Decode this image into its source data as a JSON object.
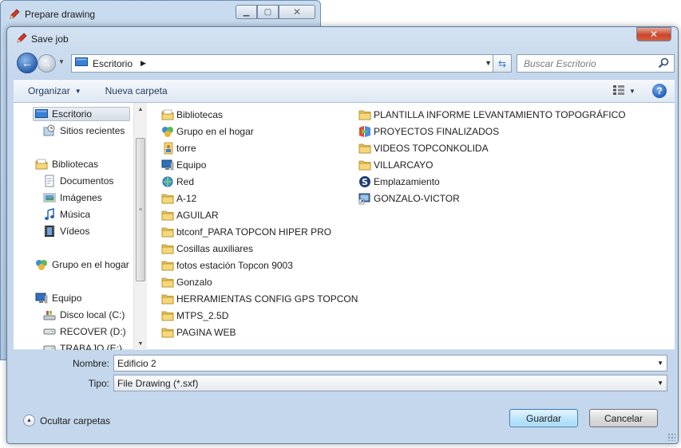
{
  "background_window": {
    "title": "Prepare drawing"
  },
  "dialog": {
    "title": "Save job"
  },
  "address_bar": {
    "crumb": "Escritorio",
    "search_placeholder": "Buscar Escritorio"
  },
  "toolbar": {
    "organize": "Organizar",
    "new_folder": "Nueva carpeta"
  },
  "nav_pane": {
    "items": [
      {
        "label": "Escritorio",
        "icon": "desktop-icon",
        "selected": true
      },
      {
        "label": "Sitios recientes",
        "icon": "recent-places-icon"
      },
      {
        "label": "Bibliotecas",
        "icon": "libraries-icon"
      },
      {
        "label": "Documentos",
        "icon": "documents-icon"
      },
      {
        "label": "Imágenes",
        "icon": "pictures-icon"
      },
      {
        "label": "Música",
        "icon": "music-icon"
      },
      {
        "label": "Vídeos",
        "icon": "videos-icon"
      },
      {
        "label": "Grupo en el hogar",
        "icon": "homegroup-icon"
      },
      {
        "label": "Equipo",
        "icon": "computer-icon"
      },
      {
        "label": "Disco local (C:)",
        "icon": "local-disk-icon"
      },
      {
        "label": "RECOVER (D:)",
        "icon": "drive-icon"
      },
      {
        "label": "TRABAJO (E:)",
        "icon": "drive-icon"
      }
    ]
  },
  "files": {
    "column1": [
      {
        "label": "Bibliotecas",
        "icon": "libraries-icon"
      },
      {
        "label": "Grupo en el hogar",
        "icon": "homegroup-icon"
      },
      {
        "label": "torre",
        "icon": "user-folder-icon"
      },
      {
        "label": "Equipo",
        "icon": "computer-icon"
      },
      {
        "label": "Red",
        "icon": "network-icon"
      },
      {
        "label": "A-12",
        "icon": "folder-icon"
      },
      {
        "label": "AGUILAR",
        "icon": "folder-icon"
      },
      {
        "label": "btconf_PARA TOPCON HIPER PRO",
        "icon": "folder-icon"
      },
      {
        "label": "Cosillas auxiliares",
        "icon": "folder-icon"
      },
      {
        "label": "fotos estación Topcon 9003",
        "icon": "folder-icon"
      },
      {
        "label": "Gonzalo",
        "icon": "folder-icon"
      },
      {
        "label": "HERRAMIENTAS CONFIG GPS TOPCON",
        "icon": "folder-icon"
      },
      {
        "label": "MTPS_2.5D",
        "icon": "folder-icon"
      },
      {
        "label": "PAGINA WEB",
        "icon": "folder-icon"
      }
    ],
    "column2": [
      {
        "label": "PLANTILLA INFORME LEVANTAMIENTO TOPOGRÁFICO",
        "icon": "folder-icon"
      },
      {
        "label": "PROYECTOS FINALIZADOS",
        "icon": "app-shortcut-icon"
      },
      {
        "label": "VIDEOS TOPCONKOLIDA",
        "icon": "folder-icon"
      },
      {
        "label": "VILLARCAYO",
        "icon": "folder-icon"
      },
      {
        "label": "Emplazamiento",
        "icon": "s-shortcut-icon"
      },
      {
        "label": "GONZALO-VICTOR",
        "icon": "shortcut-icon"
      }
    ]
  },
  "form": {
    "name_label": "Nombre:",
    "name_value": "Edificio 2",
    "type_label": "Tipo:",
    "type_value": "File Drawing (*.sxf)"
  },
  "footer": {
    "hide_folders": "Ocultar carpetas",
    "save": "Guardar",
    "cancel": "Cancelar"
  }
}
